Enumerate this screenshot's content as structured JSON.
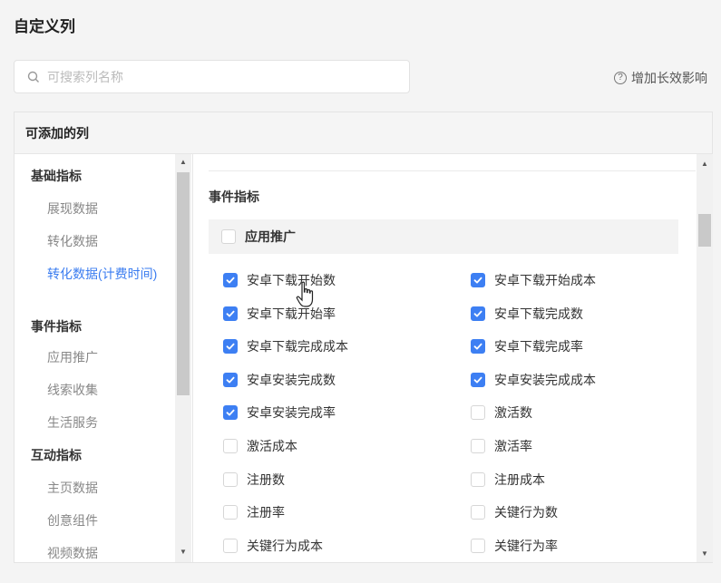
{
  "page_title": "自定义列",
  "search": {
    "placeholder": "可搜索列名称"
  },
  "help_link": "增加长效影响",
  "panel": {
    "header": "可添加的列",
    "sidebar": [
      {
        "type": "category",
        "label": "基础指标"
      },
      {
        "type": "item",
        "label": "展现数据"
      },
      {
        "type": "item",
        "label": "转化数据"
      },
      {
        "type": "item",
        "label": "转化数据(计费时间)",
        "active": true
      },
      {
        "type": "category",
        "label": "事件指标"
      },
      {
        "type": "item",
        "label": "应用推广"
      },
      {
        "type": "item",
        "label": "线索收集"
      },
      {
        "type": "item",
        "label": "生活服务"
      },
      {
        "type": "category",
        "label": "互动指标"
      },
      {
        "type": "item",
        "label": "主页数据"
      },
      {
        "type": "item",
        "label": "创意组件"
      },
      {
        "type": "item",
        "label": "视频数据"
      }
    ],
    "section_title": "事件指标",
    "group": {
      "label": "应用推广",
      "checked": false
    },
    "columns": [
      {
        "label": "安卓下载开始数",
        "checked": true
      },
      {
        "label": "安卓下载开始成本",
        "checked": true
      },
      {
        "label": "安卓下载开始率",
        "checked": true
      },
      {
        "label": "安卓下载完成数",
        "checked": true
      },
      {
        "label": "安卓下载完成成本",
        "checked": true
      },
      {
        "label": "安卓下载完成率",
        "checked": true
      },
      {
        "label": "安卓安装完成数",
        "checked": true
      },
      {
        "label": "安卓安装完成成本",
        "checked": true
      },
      {
        "label": "安卓安装完成率",
        "checked": true
      },
      {
        "label": "激活数",
        "checked": false
      },
      {
        "label": "激活成本",
        "checked": false
      },
      {
        "label": "激活率",
        "checked": false
      },
      {
        "label": "注册数",
        "checked": false
      },
      {
        "label": "注册成本",
        "checked": false
      },
      {
        "label": "注册率",
        "checked": false
      },
      {
        "label": "关键行为数",
        "checked": false
      },
      {
        "label": "关键行为成本",
        "checked": false
      },
      {
        "label": "关键行为率",
        "checked": false
      }
    ]
  },
  "colors": {
    "accent": "#3d7ff3",
    "active_link": "#3a7cf0"
  }
}
